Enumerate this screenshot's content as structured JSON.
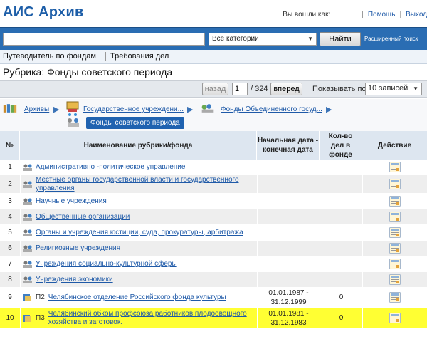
{
  "header": {
    "logo": "АИС Архив",
    "logged_in_as": "Вы вошли как:",
    "help_link": "Помощь",
    "logout_link": "Выход"
  },
  "search": {
    "query": "",
    "category_selected": "Все категории",
    "find_button": "Найти",
    "advanced_link": "Расширенный поиск"
  },
  "nav": {
    "tab_guide": "Путеводитель по фондам",
    "tab_requirements": "Требования дел"
  },
  "section": {
    "title": "Рубрика: Фонды советского периода"
  },
  "pager": {
    "prev": "назад",
    "page": "1",
    "total": "/ 324",
    "next": "вперед",
    "per_page_label": "Показывать по",
    "per_page_selected": "10 записей"
  },
  "breadcrumbs": {
    "items": [
      "Архивы",
      "Государственное учреждени...",
      "Фонды Объединенного госуд..."
    ],
    "current": "Фонды советского периода"
  },
  "table": {
    "columns": {
      "num": "№",
      "name": "Наименование рубрики/фонда",
      "dates_start": "Начальная дата -",
      "dates_end": "конечная дата",
      "count_1": "Кол-во",
      "count_2": "дел в",
      "count_3": "фонде",
      "action": "Действие"
    },
    "rows": [
      {
        "num": "1",
        "code": "",
        "name": "Административно -политическое управление",
        "date_start": "",
        "date_end": "",
        "count": "",
        "highlight": false
      },
      {
        "num": "2",
        "code": "",
        "name": "Местные органы государственной власти и государственного управления",
        "date_start": "",
        "date_end": "",
        "count": "",
        "highlight": false
      },
      {
        "num": "3",
        "code": "",
        "name": "Научные учреждения",
        "date_start": "",
        "date_end": "",
        "count": "",
        "highlight": false
      },
      {
        "num": "4",
        "code": "",
        "name": "Общественные организации",
        "date_start": "",
        "date_end": "",
        "count": "",
        "highlight": false
      },
      {
        "num": "5",
        "code": "",
        "name": "Органы и учреждения юстиции, суда, прокуратуры, арбитража",
        "date_start": "",
        "date_end": "",
        "count": "",
        "highlight": false
      },
      {
        "num": "6",
        "code": "",
        "name": "Религиозные учреждения",
        "date_start": "",
        "date_end": "",
        "count": "",
        "highlight": false
      },
      {
        "num": "7",
        "code": "",
        "name": "Учреждения социально-культурной сферы",
        "date_start": "",
        "date_end": "",
        "count": "",
        "highlight": false
      },
      {
        "num": "8",
        "code": "",
        "name": "Учреждения экономики",
        "date_start": "",
        "date_end": "",
        "count": "",
        "highlight": false
      },
      {
        "num": "9",
        "code": "П2",
        "name": "Челябинское отделение Российского фонда культуры",
        "date_start": "01.01.1987 -",
        "date_end": "31.12.1999",
        "count": "0",
        "highlight": false
      },
      {
        "num": "10",
        "code": "П3",
        "name": "Челябинский обком профсоюза работников плодоовощного хозяйства и заготовок.",
        "date_start": "01.01.1981 -",
        "date_end": "31.12.1983",
        "count": "0",
        "highlight": true
      }
    ]
  },
  "colors": {
    "brand_blue": "#1d5ea8",
    "search_bar": "#2a6db3",
    "header_row": "#dde6f0",
    "row_alt": "#eeeeee",
    "row_highlight": "#ffff33",
    "link": "#1f5aa8"
  },
  "icons": {
    "folder_rubric": "folder-tree-icon",
    "fund": "fund-doc-icon",
    "action": "view-card-icon",
    "archives": "books-icon",
    "gov": "building-icon",
    "funds_group": "funds-group-icon"
  }
}
